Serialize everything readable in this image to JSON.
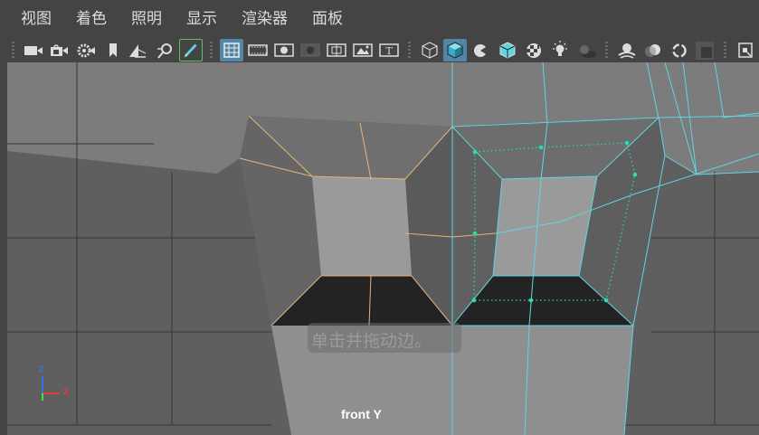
{
  "menu": [
    {
      "id": "view",
      "label": "视图"
    },
    {
      "id": "shading",
      "label": "着色"
    },
    {
      "id": "lighting",
      "label": "照明"
    },
    {
      "id": "show",
      "label": "显示"
    },
    {
      "id": "renderer",
      "label": "渲染器"
    },
    {
      "id": "panels",
      "label": "面板"
    }
  ],
  "toolbar": {
    "icons": [
      "select-camera-icon",
      "camera-attributes-icon",
      "bookmark-icon",
      "image-plane-icon",
      "2d-pan-zoom-icon",
      "grease-pencil-icon",
      "grid-icon",
      "film-gate-icon",
      "resolution-gate-icon",
      "gate-mask-icon",
      "field-chart-icon",
      "safe-action-icon",
      "safe-title-icon",
      "wireframe-icon",
      "smooth-shade-icon",
      "default-material-icon",
      "shaded-wireframe-icon",
      "textured-icon",
      "use-all-lights-icon",
      "shadows-icon",
      "screen-space-ambient-occlusion-icon",
      "motion-blur-icon",
      "multisample-antialiasing-icon",
      "depth-of-field-icon",
      "isolate-select-icon",
      "xray-icon"
    ],
    "active": [
      "grid-icon",
      "shaded-wireframe-icon"
    ]
  },
  "viewport": {
    "camera_label": "front Y",
    "hint": "单击并拖动边。",
    "axis": {
      "z": "z",
      "x": "x"
    }
  },
  "colors": {
    "background": "#444444",
    "viewport_bg": "#5f5f5f",
    "wire_selected": "#5fd6e3",
    "edge_highlight": "#e8b27a",
    "component": "#26e0a8",
    "active_button": "#5285a6"
  }
}
